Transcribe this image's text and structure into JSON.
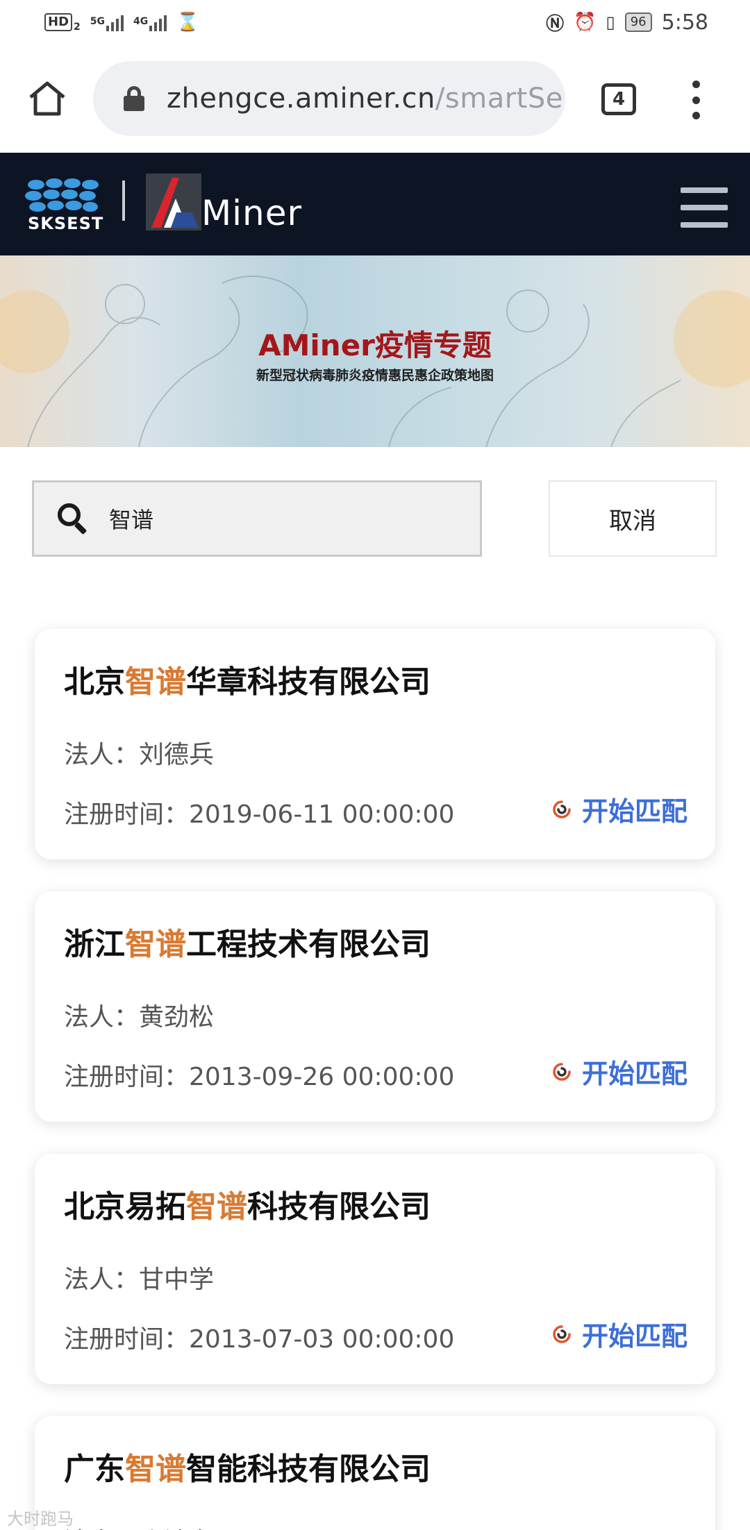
{
  "status_bar": {
    "left_hd": "HD",
    "left_hd_sub": "2",
    "signal1_label": "5G",
    "signal2_label": "4G",
    "battery": "96",
    "time": "5:58"
  },
  "browser": {
    "url_host": "zhengce.aminer.cn",
    "url_path": "/smartSe",
    "tab_count": "4"
  },
  "header": {
    "org_logo_text": "SKSEST",
    "brand_name": "Miner"
  },
  "banner": {
    "title": "AMiner疫情专题",
    "subtitle": "新型冠状病毒肺炎疫情惠民惠企政策地图"
  },
  "search": {
    "value": "智谱",
    "cancel_label": "取消"
  },
  "results": [
    {
      "name_before": "北京",
      "name_highlight": "智谱",
      "name_after": "华章科技有限公司",
      "legal_person": "法人：刘德兵",
      "registered": "注册时间：2019-06-11 00:00:00",
      "action": "开始匹配"
    },
    {
      "name_before": "浙江",
      "name_highlight": "智谱",
      "name_after": "工程技术有限公司",
      "legal_person": "法人：黄劲松",
      "registered": "注册时间：2013-09-26 00:00:00",
      "action": "开始匹配"
    },
    {
      "name_before": "北京易拓",
      "name_highlight": "智谱",
      "name_after": "科技有限公司",
      "legal_person": "法人：甘中学",
      "registered": "注册时间：2013-07-03 00:00:00",
      "action": "开始匹配"
    },
    {
      "name_before": "广东",
      "name_highlight": "智谱",
      "name_after": "智能科技有限公司",
      "legal_person": "法人：张浩东",
      "registered": "",
      "action": ""
    }
  ],
  "watermark": "大时跑马",
  "colors": {
    "header_bg": "#0d1524",
    "banner_title": "#a4161a",
    "highlight": "#d97a32",
    "action_link": "#3d6fd8"
  }
}
